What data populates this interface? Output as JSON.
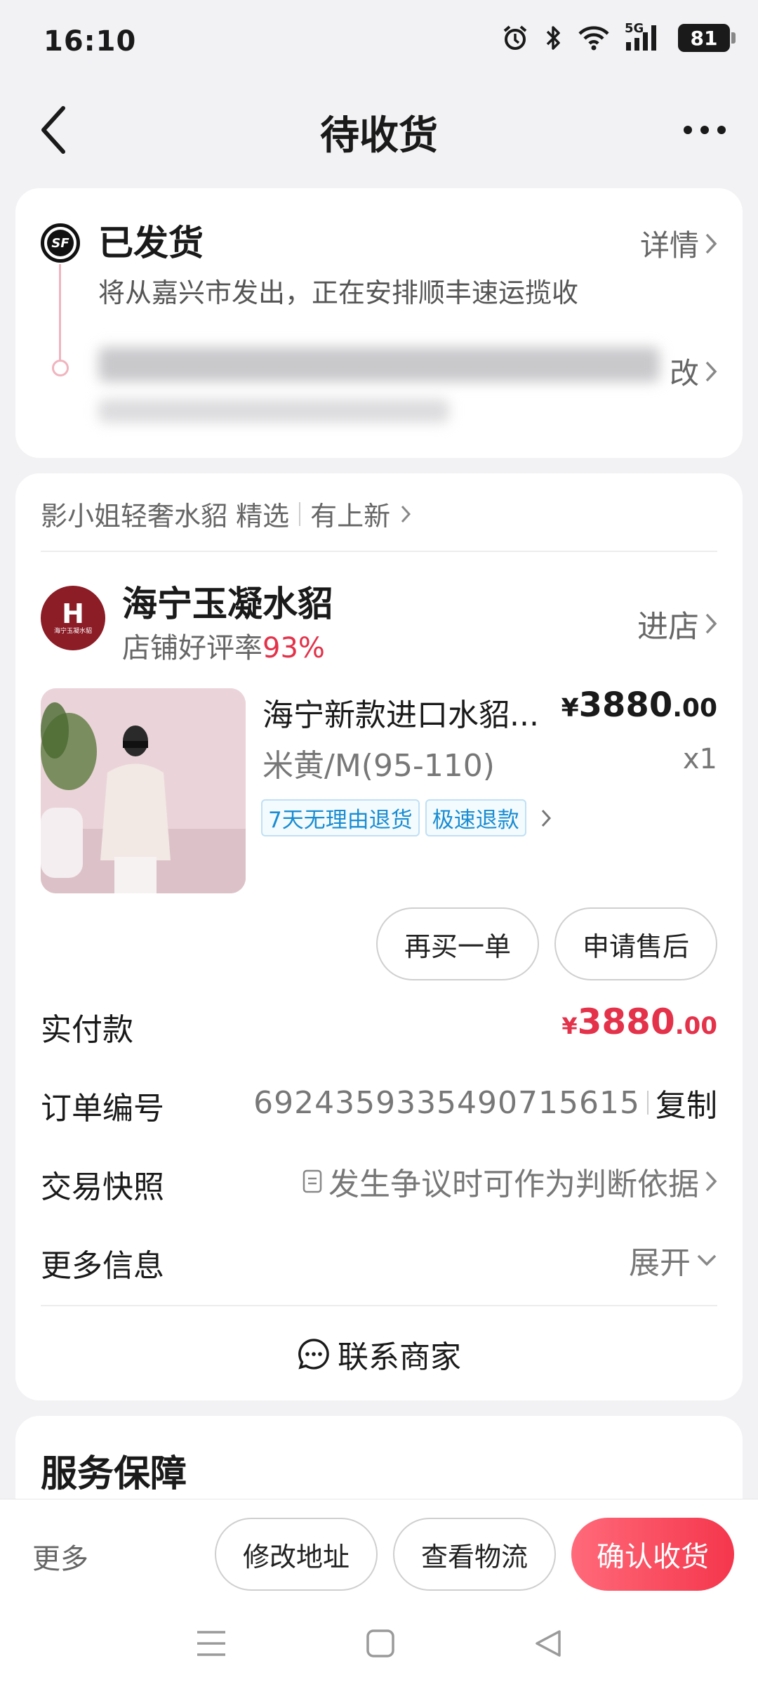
{
  "status_bar": {
    "time": "16:10",
    "network": "5G",
    "battery": "81"
  },
  "nav": {
    "title": "待收货"
  },
  "shipping": {
    "status": "已发货",
    "detail_link": "详情",
    "description": "将从嘉兴市发出，正在安排顺丰速运揽收",
    "edit_link": "改",
    "carrier_logo": "SF"
  },
  "order": {
    "store_line": {
      "name": "影小姐轻奢水貂 精选",
      "new_label": "有上新"
    },
    "shop": {
      "logo_letter": "H",
      "logo_text": "海宁玉凝水貂",
      "name": "海宁玉凝水貂",
      "rating_label": "店铺好评率",
      "rating_value": "93%",
      "enter_label": "进店"
    },
    "product": {
      "name": "海宁新款进口水貂...",
      "price_symbol": "¥",
      "price_int": "3880",
      "price_dec": ".00",
      "spec": "米黄/M(95-110)",
      "qty": "x1",
      "tags": [
        "7天无理由退货",
        "极速退款"
      ]
    },
    "buttons": {
      "rebuy": "再买一单",
      "aftersale": "申请售后"
    },
    "paid": {
      "label": "实付款",
      "symbol": "¥",
      "int": "3880",
      "dec": ".00"
    },
    "order_no": {
      "label": "订单编号",
      "value": "6924359335490715615",
      "copy": "复制"
    },
    "snapshot": {
      "label": "交易快照",
      "text": "发生争议时可作为判断依据"
    },
    "more_info": {
      "label": "更多信息",
      "toggle": "展开"
    },
    "contact": "联系商家"
  },
  "service": {
    "title": "服务保障"
  },
  "bottom_bar": {
    "more": "更多",
    "change_address": "修改地址",
    "view_logistics": "查看物流",
    "confirm_receipt": "确认收货"
  },
  "colors": {
    "accent_red": "#e3324a",
    "tag_blue": "#1a8dd1",
    "confirm_gradient_start": "#ff6a7a",
    "confirm_gradient_end": "#f5364c"
  }
}
